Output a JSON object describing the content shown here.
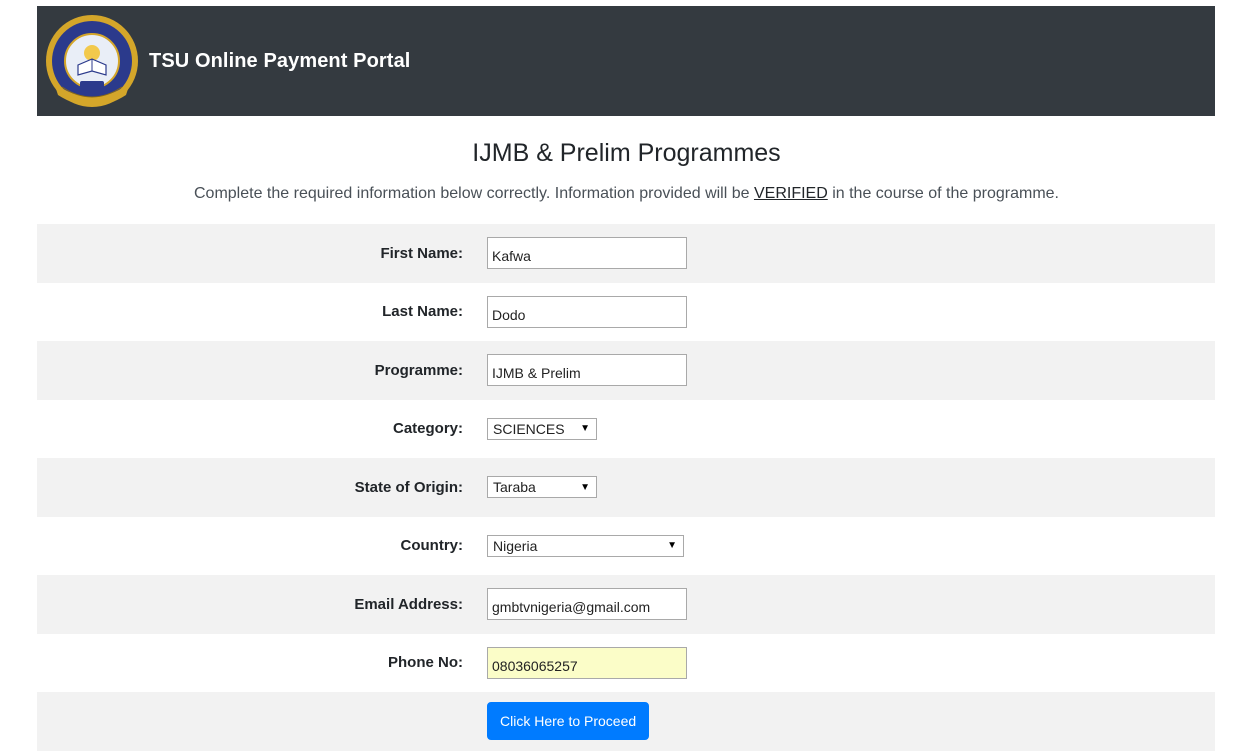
{
  "header": {
    "brand": "TSU Online Payment Portal",
    "logo_icon": "university-seal-icon"
  },
  "page": {
    "title": "IJMB & Prelim Programmes",
    "subtitle_before": "Complete the required information below correctly. Information provided will be ",
    "subtitle_emphasis": "VERIFIED",
    "subtitle_after": " in the course of the programme."
  },
  "form": {
    "first_name": {
      "label": "First Name:",
      "value": "Kafwa"
    },
    "last_name": {
      "label": "Last Name:",
      "value": "Dodo"
    },
    "programme": {
      "label": "Programme:",
      "value": "IJMB & Prelim"
    },
    "category": {
      "label": "Category:",
      "selected": "SCIENCES"
    },
    "state_of_origin": {
      "label": "State of Origin:",
      "selected": "Taraba"
    },
    "country": {
      "label": "Country:",
      "selected": "Nigeria"
    },
    "email": {
      "label": "Email Address:",
      "value": "gmbtvnigeria@gmail.com"
    },
    "phone": {
      "label": "Phone No:",
      "value": "08036065257"
    },
    "submit_label": "Click Here to Proceed"
  },
  "colors": {
    "header_bg": "#343a40",
    "stripe_bg": "#f2f2f2",
    "primary": "#007bff",
    "autofill_bg": "#fbfdc8"
  }
}
